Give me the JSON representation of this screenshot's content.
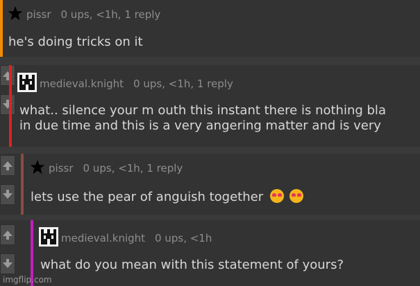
{
  "colors": {
    "bar_orange": "#f08c00",
    "bar_red": "#e02020",
    "bar_brown": "#8a4b43",
    "bar_magenta": "#c020c0",
    "background": "#333333"
  },
  "comments": [
    {
      "user": "pissr",
      "avatar_icon": "star-icon",
      "meta": "0 ups, <1h, 1 reply",
      "text": "he's doing tricks on it"
    },
    {
      "user": "medieval.knight",
      "avatar_icon": "castle-icon",
      "meta": "0 ups, <1h, 1 reply",
      "text_line1": "what.. silence your m outh this instant there is nothing bla",
      "text_line2": "in due time and this is a very angering matter and is very"
    },
    {
      "user": "pissr",
      "avatar_icon": "star-icon",
      "meta": "0 ups, <1h, 1 reply",
      "text": "lets use the pear of anguish together"
    },
    {
      "user": "medieval.knight",
      "avatar_icon": "castle-icon",
      "meta": "0 ups, <1h",
      "text": "what do you mean with this statement of yours?"
    }
  ],
  "watermark": "imgflip.com"
}
